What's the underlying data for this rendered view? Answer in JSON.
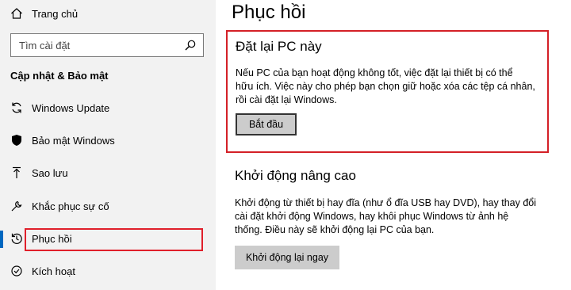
{
  "sidebar": {
    "home_label": "Trang chủ",
    "search_placeholder": "Tìm cài đặt",
    "section_title": "Cập nhật & Bảo mật",
    "items": [
      {
        "label": "Windows Update",
        "icon": "sync-icon"
      },
      {
        "label": "Bảo mật Windows",
        "icon": "shield-icon"
      },
      {
        "label": "Sao lưu",
        "icon": "backup-arrow-icon"
      },
      {
        "label": "Khắc phục sự cố",
        "icon": "wrench-icon"
      },
      {
        "label": "Phục hồi",
        "icon": "recovery-icon",
        "active": true
      },
      {
        "label": "Kích hoạt",
        "icon": "activation-icon"
      }
    ]
  },
  "main": {
    "title": "Phục hồi",
    "reset": {
      "heading": "Đặt lại PC này",
      "lines": [
        "Nếu PC của bạn hoạt động không tốt, việc đặt lại thiết bị có thể",
        "hữu ích. Việc này cho phép bạn chọn giữ hoặc xóa các tệp cá nhân,",
        "rồi cài đặt lại Windows."
      ],
      "button": "Bắt đầu"
    },
    "advanced": {
      "heading": "Khởi động nâng cao",
      "lines": [
        "Khởi động từ thiết bị hay đĩa (như ổ đĩa USB hay DVD), hay thay đổi",
        "cài đặt khởi động Windows, hay khôi phục Windows từ ảnh hệ",
        "thống. Điều này sẽ khởi động lại PC của bạn."
      ],
      "button": "Khởi động lại ngay"
    }
  },
  "colors": {
    "accent": "#0067c0",
    "highlight_red": "#e0202b",
    "sidebar_bg": "#f2f2f2",
    "button_bg": "#cccccc"
  }
}
